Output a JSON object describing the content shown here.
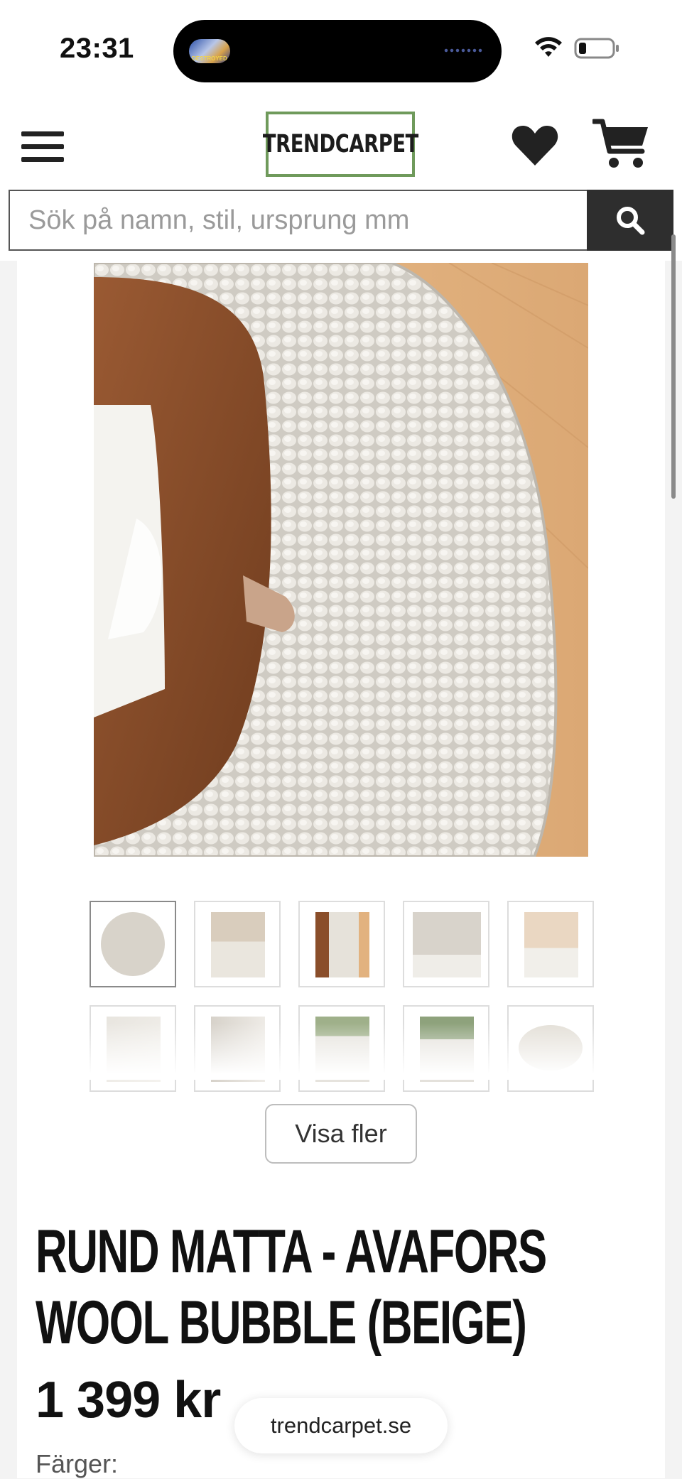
{
  "status_bar": {
    "time": "23:31",
    "island_badge": "DESTROYED"
  },
  "header": {
    "logo_text": "TRENDCARPET",
    "menu_icon": "hamburger-menu-icon",
    "wishlist_icon": "heart-icon",
    "cart_icon": "cart-icon"
  },
  "search": {
    "placeholder": "Sök på namn, stil, ursprung mm",
    "button_icon": "search-icon"
  },
  "gallery": {
    "thumbnails": [
      {
        "name": "round-rug-top-view",
        "active": true
      },
      {
        "name": "living-room-table"
      },
      {
        "name": "rug-closeup-table"
      },
      {
        "name": "room-fireplace"
      },
      {
        "name": "rug-with-stool"
      },
      {
        "name": "rug-with-plant"
      },
      {
        "name": "rug-chair-detail"
      },
      {
        "name": "room-with-plants"
      },
      {
        "name": "window-room-plant"
      },
      {
        "name": "oval-rug"
      }
    ],
    "show_more_label": "Visa fler"
  },
  "product": {
    "title": "RUND MATTA - AVAFORS WOOL BUBBLE (BEIGE)",
    "price": "1 399 kr",
    "colors_label": "Färger:"
  },
  "browser": {
    "url": "trendcarpet.se"
  },
  "colors": {
    "accent_green": "#6f9a5b",
    "search_button": "#2e2e2e",
    "rug": "#e9e6df",
    "wood_table": "#8a4e2a",
    "floor": "#e5b884"
  }
}
